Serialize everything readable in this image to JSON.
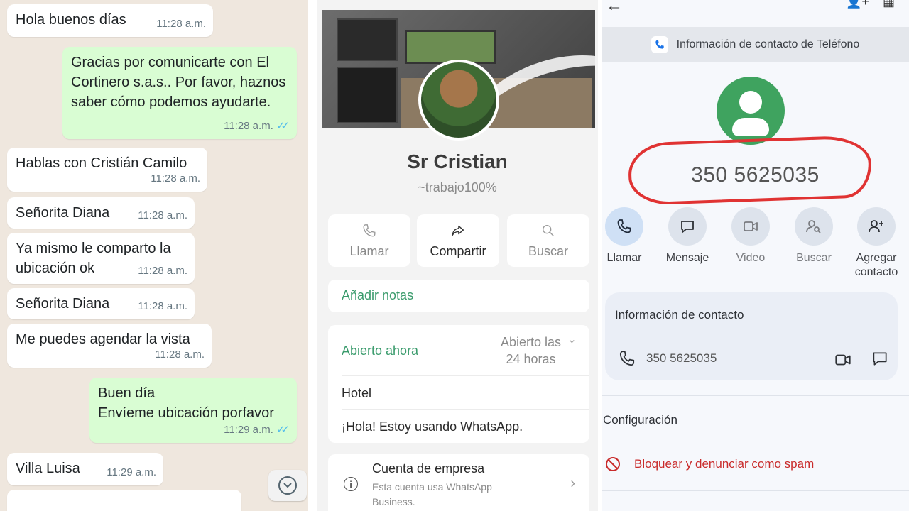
{
  "chat": {
    "messages": [
      {
        "dir": "in",
        "text": "Hola buenos días",
        "time": "11:28 a.m."
      },
      {
        "dir": "out",
        "text": "Gracias por comunicarte con El Cortinero s.a.s.. Por favor, haznos saber cómo podemos ayudarte.",
        "time": "11:28 a.m."
      },
      {
        "dir": "in",
        "text": "Hablas con Cristián Camilo",
        "time": "11:28 a.m."
      },
      {
        "dir": "in",
        "text": "Señorita Diana",
        "time": "11:28 a.m."
      },
      {
        "dir": "in",
        "text": "Ya mismo le comparto la ubicación ok",
        "time": "11:28 a.m."
      },
      {
        "dir": "in",
        "text": "Señorita Diana",
        "time": "11:28 a.m."
      },
      {
        "dir": "in",
        "text": "Me puedes agendar la vista",
        "time": "11:28 a.m."
      },
      {
        "dir": "out",
        "text": "Buen día\nEnvíeme ubicación porfavor",
        "time": "11:29 a.m."
      },
      {
        "dir": "in",
        "text": "Villa Luisa",
        "time": "11:29 a.m."
      }
    ],
    "scroll_icon": "chevron-down-circle-icon"
  },
  "profile": {
    "name": "Sr Cristian",
    "status": "~trabajo100%",
    "actions": [
      {
        "label": "Llamar",
        "icon": "phone-icon"
      },
      {
        "label": "Compartir",
        "icon": "share-icon"
      },
      {
        "label": "Buscar",
        "icon": "search-icon"
      }
    ],
    "notes_label": "Añadir notas",
    "open_now": "Abierto ahora",
    "open_hours": "Abierto las\n24 horas",
    "category": "Hotel",
    "about": "¡Hola! Estoy usando WhatsApp.",
    "business_title": "Cuenta de empresa",
    "business_desc": "Esta cuenta usa WhatsApp Business."
  },
  "contact": {
    "source": "Información de contacto de Teléfono",
    "phone": "350 5625035",
    "actions": [
      {
        "label": "Llamar",
        "icon": "phone-icon"
      },
      {
        "label": "Mensaje",
        "icon": "message-icon"
      },
      {
        "label": "Video",
        "icon": "video-icon"
      },
      {
        "label": "Buscar",
        "icon": "person-search-icon"
      },
      {
        "label": "Agregar contacto",
        "icon": "add-person-icon"
      }
    ],
    "info_title": "Información de contacto",
    "info_phone": "350 5625035",
    "settings_title": "Configuración",
    "block_label": "Bloquear y denunciar como spam",
    "colors": {
      "accent_green": "#3fa35f",
      "danger": "#c92b2b",
      "highlight": "#e03333"
    }
  }
}
